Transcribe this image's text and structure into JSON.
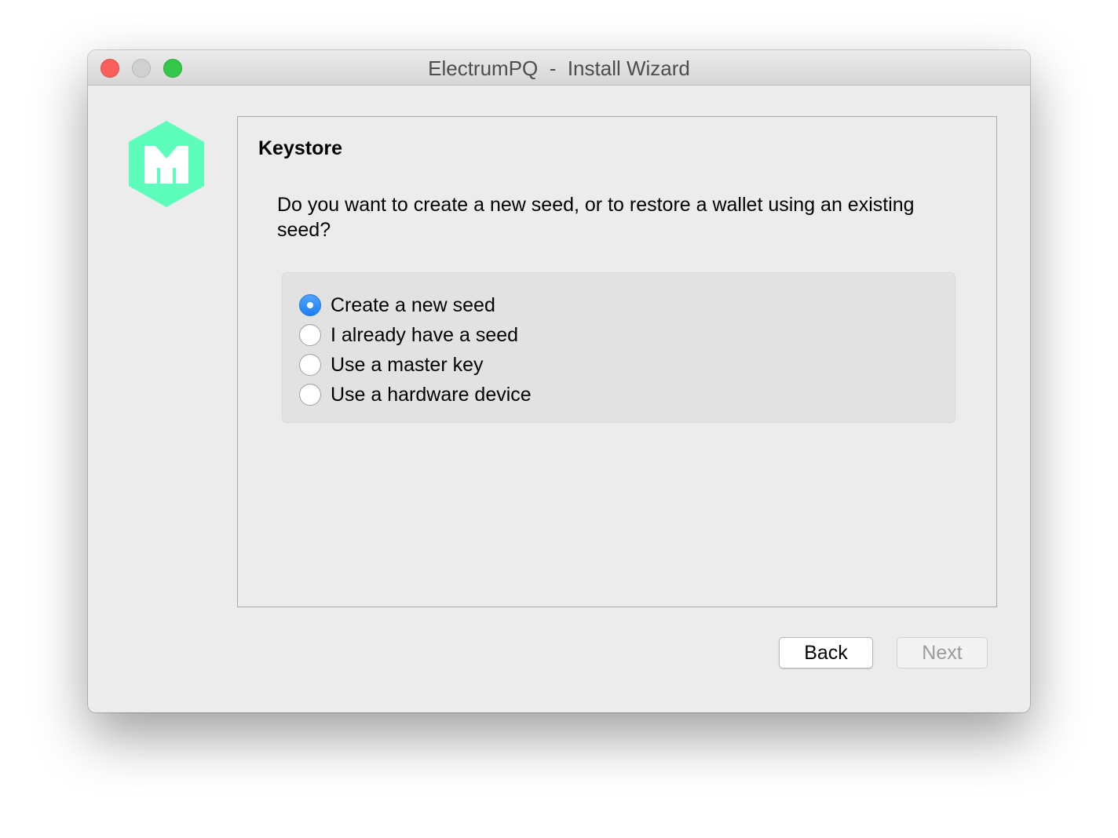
{
  "window": {
    "title": "ElectrumPQ  -  Install Wizard"
  },
  "icons": {
    "logo": "electrumpq-logo-icon",
    "logo_color": "#5dfdbb"
  },
  "wizard": {
    "heading": "Keystore",
    "question": "Do you want to create a new seed, or to restore a wallet using an existing seed?",
    "options": [
      {
        "label": "Create a new seed",
        "checked": true
      },
      {
        "label": "I already have a seed",
        "checked": false
      },
      {
        "label": "Use a master key",
        "checked": false
      },
      {
        "label": "Use a hardware device",
        "checked": false
      }
    ]
  },
  "buttons": {
    "back": "Back",
    "next": "Next",
    "next_enabled": false
  },
  "colors": {
    "accent": "#2a86f7",
    "traffic_close": "#fc605c",
    "traffic_minimize": "#d0d0d0",
    "traffic_zoom": "#34c84a"
  }
}
